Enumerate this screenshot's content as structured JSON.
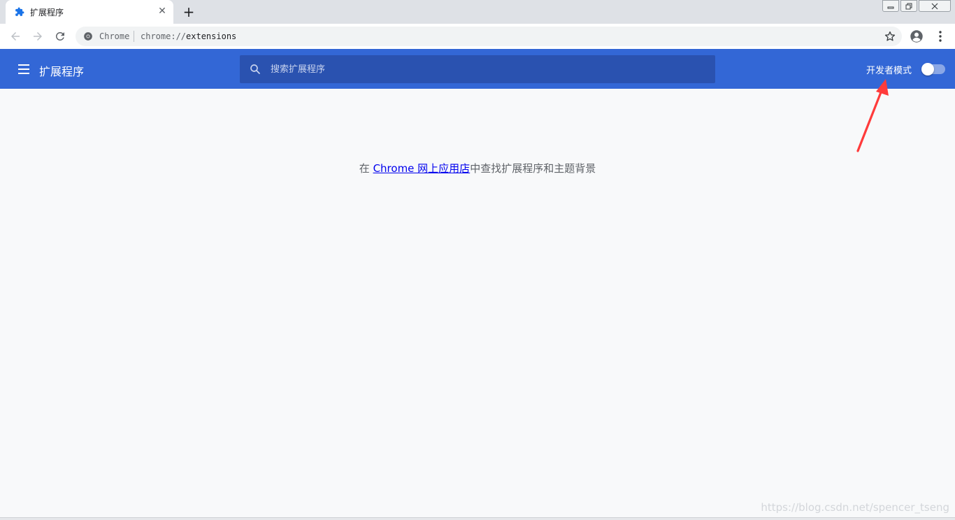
{
  "tab": {
    "title": "扩展程序",
    "close_glyph": "✕",
    "new_tab_glyph": "+",
    "favicon": "puzzle-icon"
  },
  "window_controls": [
    "minimize-icon",
    "restore-icon",
    "close-icon"
  ],
  "toolbar": {
    "back": "arrow-left-icon",
    "forward": "arrow-right-icon",
    "reload": "reload-icon"
  },
  "omnibox": {
    "site_label": "Chrome",
    "url_scheme": "chrome://",
    "url_path": "extensions",
    "bookmark": "star-icon"
  },
  "header": {
    "title": "扩展程序",
    "search_placeholder": "搜索扩展程序",
    "dev_mode_label": "开发者模式",
    "dev_mode_enabled": false
  },
  "main": {
    "prefix": "在 ",
    "link_text": "Chrome 网上应用店",
    "suffix": "中查找扩展程序和主题背景"
  },
  "watermark": "https://blog.csdn.net/spencer_tseng",
  "colors": {
    "header_bg": "#3367d6",
    "search_bg": "#2a52b0",
    "page_bg": "#f8f9fa",
    "link": "#0000ee",
    "annotation": "#ff3b3b"
  }
}
